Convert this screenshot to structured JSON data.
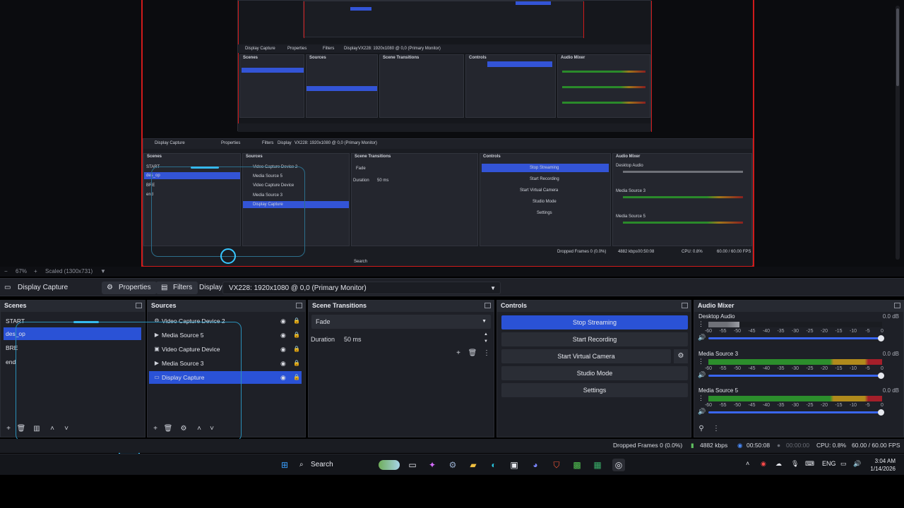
{
  "preview": {
    "mini_titlebar": {
      "source": "Display Capture",
      "properties": "Properties",
      "filters": "Filters",
      "display_label": "Display",
      "display_value": "VX228: 1920x1080 @ 0,0 (Primary Monitor)"
    },
    "mini_docks": {
      "scenes": "Scenes",
      "sources": "Sources",
      "transitions": "Scene Transitions",
      "controls": "Controls",
      "mixer": "Audio Mixer"
    },
    "mini_scenes": [
      "START",
      "des_op",
      "BRE",
      "end"
    ],
    "mini_sources": [
      "Video Capture Device 2",
      "Media Source 5",
      "Video Capture Device",
      "Media Source 3",
      "Display Capture"
    ],
    "mini_transition": {
      "value": "Fade",
      "duration_label": "Duration",
      "duration_value": "50 ms"
    },
    "mini_controls": [
      "Stop Streaming",
      "Start Recording",
      "Start Virtual Camera",
      "Studio Mode",
      "Settings"
    ],
    "mini_mixer": [
      "Desktop Audio",
      "Media Source 3",
      "Media Source 5"
    ],
    "mini_status": {
      "dropped": "Dropped Frames 0 (0.0%)",
      "kbps": "4882 kbps",
      "time": "00:50:08",
      "cpu": "CPU: 0.8%",
      "fps": "60.00 / 60.00 FPS"
    },
    "mini_search": "Search",
    "mini_zoom": "67%",
    "mini_scaled": "Scaled (1300x731)"
  },
  "status_top": {
    "zoom": "67%",
    "scaled": "Scaled (1300x731)"
  },
  "toolbar": {
    "source_name": "Display Capture",
    "properties": "Properties",
    "filters": "Filters",
    "display_label": "Display",
    "display_value": "VX228: 1920x1080 @ 0,0 (Primary Monitor)"
  },
  "scenes": {
    "title": "Scenes",
    "items": [
      {
        "label": "START",
        "active": false
      },
      {
        "label": "des_op",
        "active": true
      },
      {
        "label": "BRE",
        "active": false
      },
      {
        "label": "end",
        "active": false
      }
    ]
  },
  "sources": {
    "title": "Sources",
    "items": [
      {
        "label": "Video Capture Device 2",
        "icon": "camera-icon",
        "active": false
      },
      {
        "label": "Media Source 5",
        "icon": "play-icon",
        "active": false
      },
      {
        "label": "Video Capture Device",
        "icon": "camera-icon",
        "active": false
      },
      {
        "label": "Media Source 3",
        "icon": "play-icon",
        "active": false
      },
      {
        "label": "Display Capture",
        "icon": "monitor-icon",
        "active": true
      }
    ]
  },
  "transitions": {
    "title": "Scene Transitions",
    "value": "Fade",
    "duration_label": "Duration",
    "duration_value": "50 ms"
  },
  "controls": {
    "title": "Controls",
    "buttons": [
      "Stop Streaming",
      "Start Recording",
      "Start Virtual Camera",
      "Studio Mode",
      "Settings"
    ]
  },
  "mixer": {
    "title": "Audio Mixer",
    "ticks": [
      "-60",
      "-55",
      "-50",
      "-45",
      "-40",
      "-35",
      "-30",
      "-25",
      "-20",
      "-15",
      "-10",
      "-5",
      "0"
    ],
    "channels": [
      {
        "name": "Desktop Audio",
        "db": "0.0 dB",
        "level": 0.18,
        "volume": 1.0,
        "colors": [
          "#6f7178",
          "#9a9ca3"
        ]
      },
      {
        "name": "Media Source 3",
        "db": "0.0 dB",
        "level": 1.0,
        "volume": 1.0,
        "colors": [
          "#2c8e2c",
          "#b08a1c",
          "#a41f2a"
        ]
      },
      {
        "name": "Media Source 5",
        "db": "0.0 dB",
        "level": 1.0,
        "volume": 1.0,
        "colors": [
          "#2c8e2c",
          "#b08a1c",
          "#a41f2a"
        ]
      }
    ]
  },
  "status": {
    "dropped": "Dropped Frames 0 (0.0%)",
    "kbps": "4882 kbps",
    "stream_time": "00:50:08",
    "rec_time": "00:00:00",
    "cpu": "CPU: 0.8%",
    "fps": "60.00 / 60.00 FPS"
  },
  "taskbar": {
    "search": "Search",
    "lang": "ENG",
    "time": "3:04 AM",
    "date": "1/14/2026"
  },
  "colors": {
    "accent": "#2a52d6",
    "record_red": "#d01a1a",
    "overlay_cyan": "#37c6ff"
  }
}
